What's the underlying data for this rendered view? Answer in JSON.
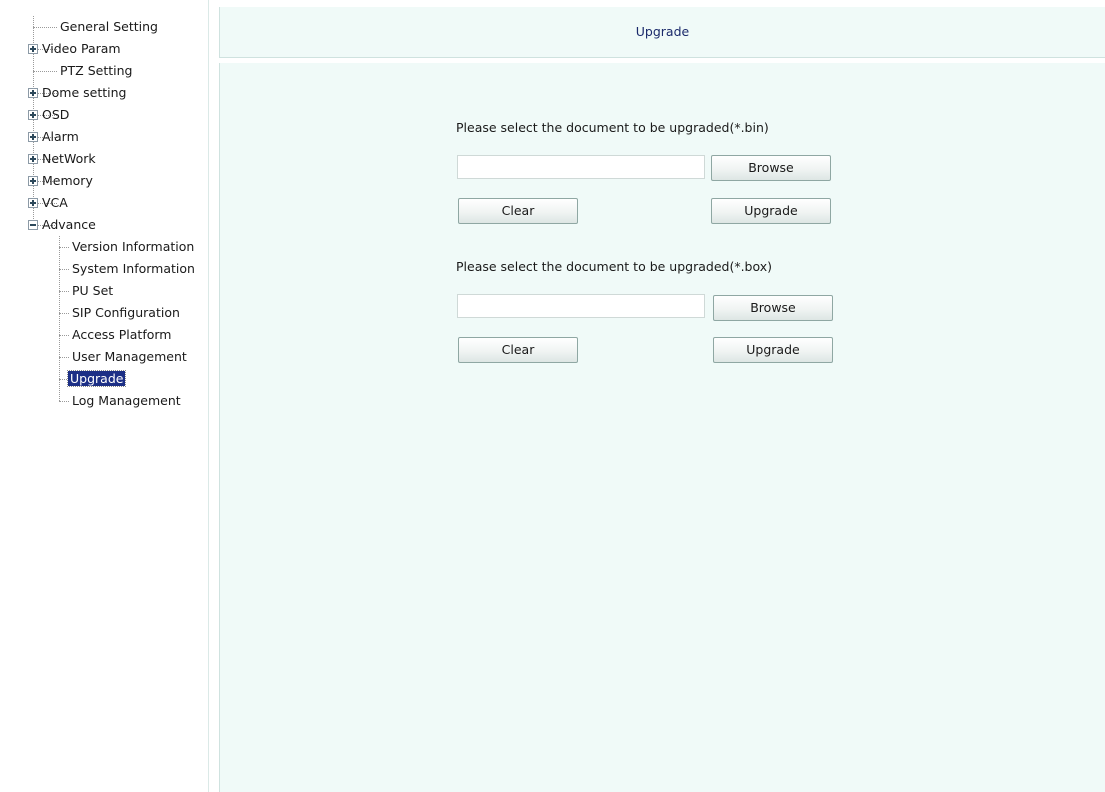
{
  "tree": {
    "items": [
      {
        "label": "General Setting"
      },
      {
        "label": "Video Param"
      },
      {
        "label": "PTZ Setting"
      },
      {
        "label": "Dome setting"
      },
      {
        "label": "OSD"
      },
      {
        "label": "Alarm"
      },
      {
        "label": "NetWork"
      },
      {
        "label": "Memory"
      },
      {
        "label": "VCA"
      },
      {
        "label": "Advance"
      },
      {
        "label": "Version Information"
      },
      {
        "label": "System Information"
      },
      {
        "label": "PU Set"
      },
      {
        "label": "SIP Configuration"
      },
      {
        "label": "Access Platform"
      },
      {
        "label": "User Management"
      },
      {
        "label": "Upgrade"
      },
      {
        "label": "Log Management"
      }
    ]
  },
  "panel": {
    "title": "Upgrade",
    "bin": {
      "prompt": "Please select the document to be upgraded(*.bin)",
      "file_value": "",
      "browse_label": "Browse",
      "clear_label": "Clear",
      "upgrade_label": "Upgrade"
    },
    "box": {
      "prompt": "Please select the document to be upgraded(*.box)",
      "file_value": "",
      "browse_label": "Browse",
      "clear_label": "Clear",
      "upgrade_label": "Upgrade"
    }
  }
}
